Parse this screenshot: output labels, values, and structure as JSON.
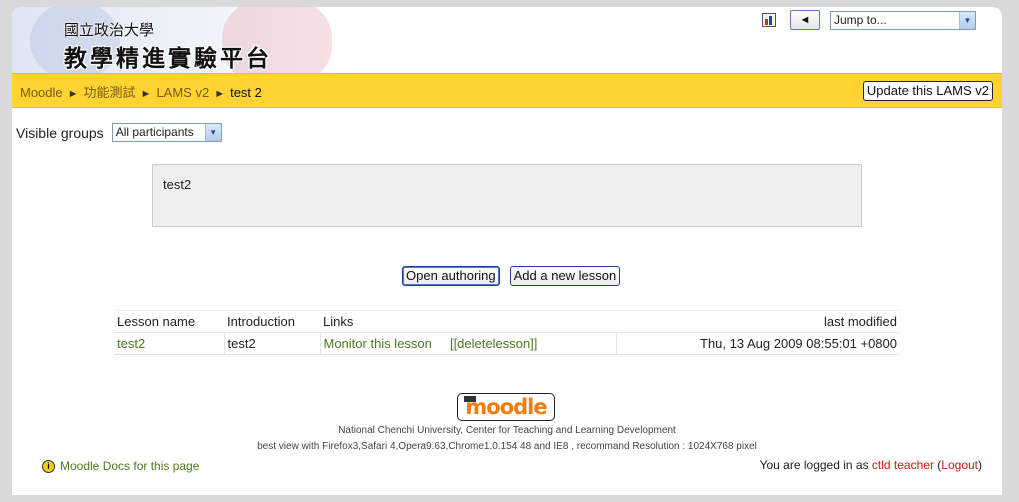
{
  "header": {
    "logo_small": "國立政治大學",
    "logo_big": "教學精進實驗平台",
    "prev_label": "◄",
    "jump_to": "Jump to..."
  },
  "navbar": {
    "breadcrumbs": [
      "Moodle",
      "功能測試",
      "LAMS v2",
      "test 2"
    ],
    "update_button": "Update this LAMS v2"
  },
  "groups": {
    "label": "Visible groups",
    "selected": "All participants"
  },
  "intro": {
    "text": "test2"
  },
  "actions": {
    "open_authoring": "Open authoring",
    "add_lesson": "Add a new lesson"
  },
  "table": {
    "headers": [
      "Lesson name",
      "Introduction",
      "Links",
      "last modified"
    ],
    "rows": [
      {
        "name": "test2",
        "introduction": "test2",
        "monitor": "Monitor this lesson",
        "delete": "[[deletelesson]]",
        "modified": "Thu, 13 Aug 2009 08:55:01 +0800"
      }
    ]
  },
  "footer": {
    "logo_text": "moodle",
    "line1": "National Chenchi University, Center for Teaching and Learning Development",
    "line2": "best view  with Firefox3,Safari 4,Opera9.63,Chrome1.0.154 48 and IE8 , recommand Resolution : 1024X768 pixel",
    "docs_link": "Moodle Docs for this page",
    "logged_prefix": "You are logged in as ",
    "user": "ctld teacher",
    "logout": "Logout"
  },
  "colors": {
    "navbar_bg": "#ffd432",
    "link_green": "#4a7a20",
    "link_red": "#c41b12",
    "moodle_orange": "#f07d0e"
  }
}
